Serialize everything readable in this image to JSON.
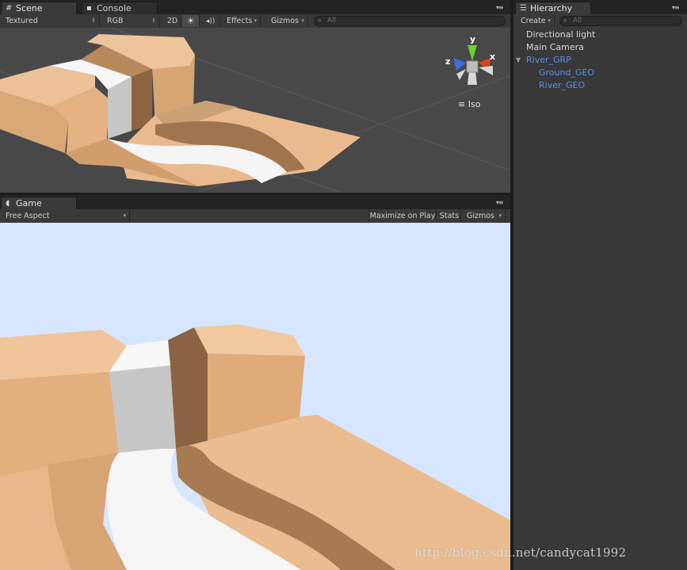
{
  "scene_panel": {
    "tabs": [
      {
        "label": "Scene",
        "icon": "grid-icon",
        "active": true
      },
      {
        "label": "Console",
        "icon": "console-icon",
        "active": false
      }
    ],
    "toolbar": {
      "shading": "Textured",
      "render_mode": "RGB",
      "mode_2d": "2D",
      "lighting_icon": "sun-icon",
      "audio_icon": "speaker-icon",
      "effects": "Effects",
      "gizmos": "Gizmos",
      "search_placeholder": "All"
    },
    "orientation_gizmo": {
      "y_label": "y",
      "x_label": "x",
      "z_label": "z",
      "projection": "Iso",
      "colors": {
        "x": "#e0401e",
        "y": "#6ccf2a",
        "z": "#3d6de8"
      }
    }
  },
  "game_panel": {
    "tab": {
      "label": "Game",
      "icon": "pacman-icon"
    },
    "toolbar": {
      "aspect": "Free Aspect",
      "maximize_on_play": "Maximize on Play",
      "stats": "Stats",
      "gizmos": "Gizmos"
    },
    "sky_color": "#d6e6ff"
  },
  "hierarchy_panel": {
    "tab": {
      "label": "Hierarchy",
      "icon": "list-icon"
    },
    "create_label": "Create",
    "search_placeholder": "All",
    "items": [
      {
        "label": "Directional light",
        "depth": 0,
        "color": "default"
      },
      {
        "label": "Main Camera",
        "depth": 0,
        "color": "default"
      },
      {
        "label": "River_GRP",
        "depth": 0,
        "color": "#5b8fe8",
        "expanded": true
      },
      {
        "label": "Ground_GEO",
        "depth": 1,
        "color": "#5b8fe8"
      },
      {
        "label": "River_GEO",
        "depth": 1,
        "color": "#5b8fe8"
      }
    ]
  },
  "watermark": "http://blog.csdn.net/candycat1992",
  "colors": {
    "terrain": "#e8b98c",
    "river": "#f4f4f4",
    "editor_dark": "#383838",
    "scene_bg": "#484848"
  }
}
